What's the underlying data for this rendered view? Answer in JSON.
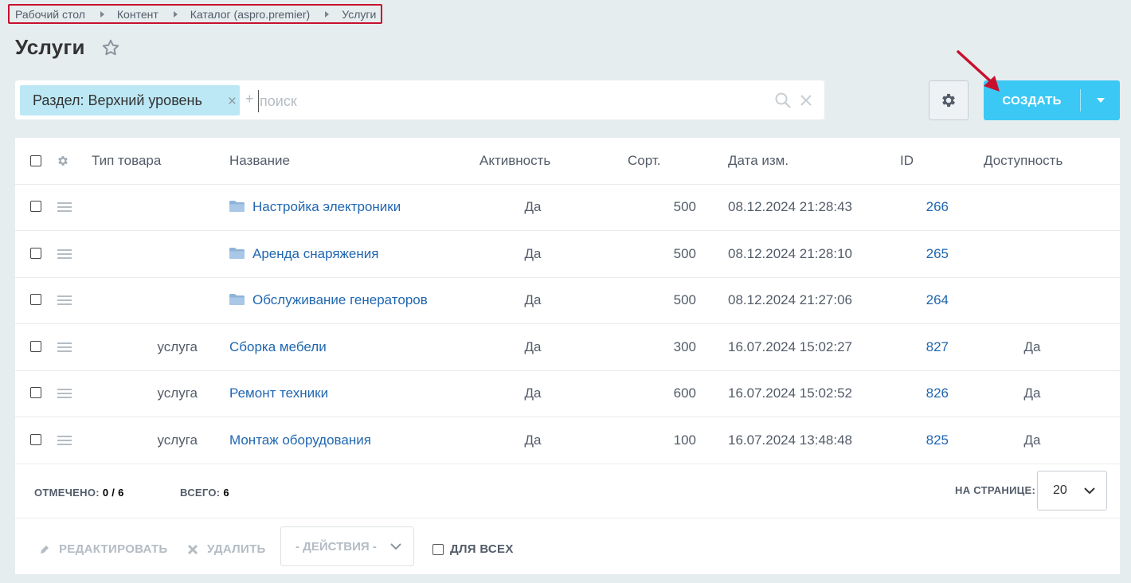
{
  "breadcrumb": [
    "Рабочий стол",
    "Контент",
    "Каталог (aspro.premier)",
    "Услуги"
  ],
  "page": {
    "title": "Услуги"
  },
  "filter": {
    "tag_label": "Раздел: Верхний уровень",
    "add_symbol": "+",
    "search_placeholder": "поиск"
  },
  "toolbar": {
    "create_label": "СОЗДАТЬ"
  },
  "table": {
    "headers": {
      "type": "Тип товара",
      "name": "Название",
      "active": "Активность",
      "sort": "Сорт.",
      "date": "Дата изм.",
      "id": "ID",
      "availability": "Доступность"
    },
    "rows": [
      {
        "type": "",
        "name": "Настройка электроники",
        "active": "Да",
        "sort": "500",
        "date": "08.12.2024 21:28:43",
        "id": "266",
        "availability": "",
        "folder": true
      },
      {
        "type": "",
        "name": "Аренда снаряжения",
        "active": "Да",
        "sort": "500",
        "date": "08.12.2024 21:28:10",
        "id": "265",
        "availability": "",
        "folder": true
      },
      {
        "type": "",
        "name": "Обслуживание генераторов",
        "active": "Да",
        "sort": "500",
        "date": "08.12.2024 21:27:06",
        "id": "264",
        "availability": "",
        "folder": true
      },
      {
        "type": "услуга",
        "name": "Сборка мебели",
        "active": "Да",
        "sort": "300",
        "date": "16.07.2024 15:02:27",
        "id": "827",
        "availability": "Да",
        "folder": false
      },
      {
        "type": "услуга",
        "name": "Ремонт техники",
        "active": "Да",
        "sort": "600",
        "date": "16.07.2024 15:02:52",
        "id": "826",
        "availability": "Да",
        "folder": false
      },
      {
        "type": "услуга",
        "name": "Монтаж оборудования",
        "active": "Да",
        "sort": "100",
        "date": "16.07.2024 13:48:48",
        "id": "825",
        "availability": "Да",
        "folder": false
      }
    ]
  },
  "footer": {
    "selected_label": "ОТМЕЧЕНО:",
    "selected_value": "0 / 6",
    "total_label": "ВСЕГО:",
    "total_value": "6",
    "per_page_label": "НА СТРАНИЦЕ:",
    "per_page_value": "20"
  },
  "actions": {
    "edit_label": "РЕДАКТИРОВАТЬ",
    "delete_label": "УДАЛИТЬ",
    "actions_select": "- ДЕЙСТВИЯ -",
    "for_all_label": "ДЛЯ ВСЕХ"
  },
  "colors": {
    "accent": "#3bc8f5",
    "link": "#2067b0",
    "background": "#e6edef",
    "filter_tag": "#bce8f6",
    "highlight_border": "#c8102e"
  }
}
